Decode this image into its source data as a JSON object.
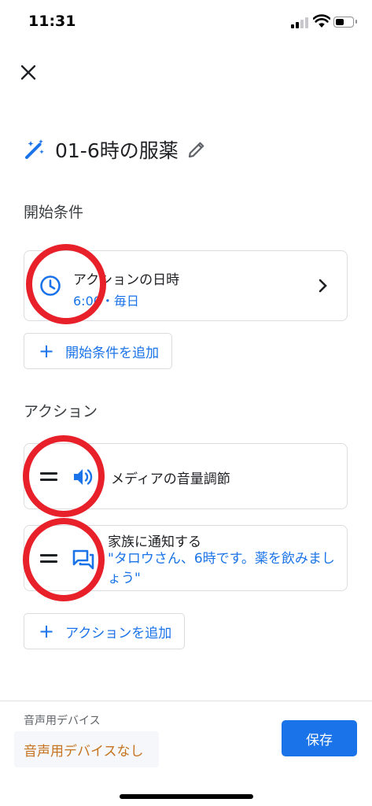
{
  "status_bar": {
    "time": "11:31",
    "battery_level": 0.55,
    "signal_bars_active": 2,
    "signal_bars_total": 4
  },
  "header": {
    "title": "01-6時の服薬",
    "icons": [
      "close-icon",
      "magic-wand-icon",
      "edit-pencil-icon"
    ]
  },
  "starters": {
    "section_label": "開始条件",
    "items": [
      {
        "title": "アクションの日時",
        "subtitle": "6:00・毎日",
        "icon": "clock-icon"
      }
    ],
    "add_label": "開始条件を追加"
  },
  "actions": {
    "section_label": "アクション",
    "items": [
      {
        "title": "メディアの音量調節",
        "icon": "speaker-icon"
      },
      {
        "title": "家族に通知する",
        "message": "\"タロウさん、6時です。薬を飲みましょう\"",
        "icon": "chat-icon"
      }
    ],
    "add_label": "アクションを追加"
  },
  "footer": {
    "device_label": "音声用デバイス",
    "device_value": "音声用デバイスなし",
    "save_label": "保存"
  },
  "colors": {
    "accent": "#1a73e8",
    "annotation": "#e8202a",
    "warning_text": "#c5731f"
  }
}
